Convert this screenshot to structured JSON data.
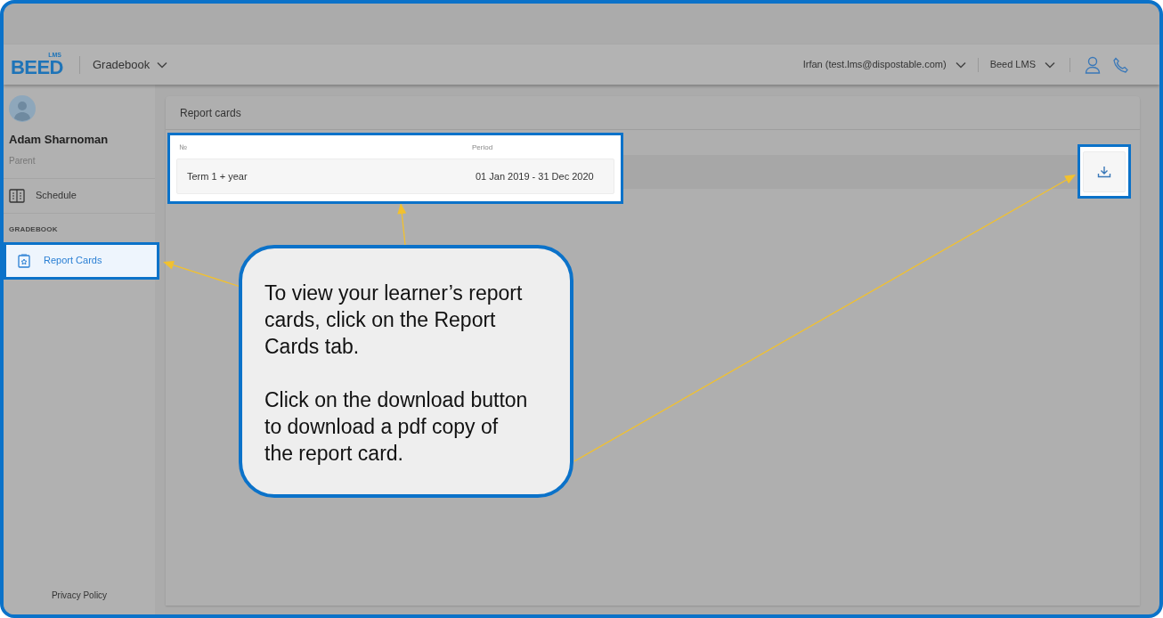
{
  "header": {
    "logo": {
      "text": "BEED",
      "badge": "LMS"
    },
    "module": "Gradebook",
    "account": "Irfan (test.lms@dispostable.com)",
    "school": "Beed LMS"
  },
  "sidebar": {
    "user": {
      "name": "Adam Sharnoman",
      "role": "Parent"
    },
    "nav": [
      {
        "kind": "item",
        "label": "Schedule",
        "selected": false
      },
      {
        "kind": "section",
        "label": "GRADEBOOK"
      },
      {
        "kind": "item",
        "label": "Report Cards",
        "selected": true
      }
    ],
    "footer": "Privacy Policy"
  },
  "main": {
    "title": "Report cards",
    "table": {
      "columns": [
        "№",
        "Period"
      ],
      "rows": [
        [
          "Term 1 + year",
          "01 Jan 2019 - 31 Dec 2020"
        ]
      ]
    }
  },
  "callout": {
    "paragraphs": [
      "To view your learner’s report cards, click on the Report Cards tab.",
      "Click on the download button to download a pdf copy of the report card."
    ]
  }
}
